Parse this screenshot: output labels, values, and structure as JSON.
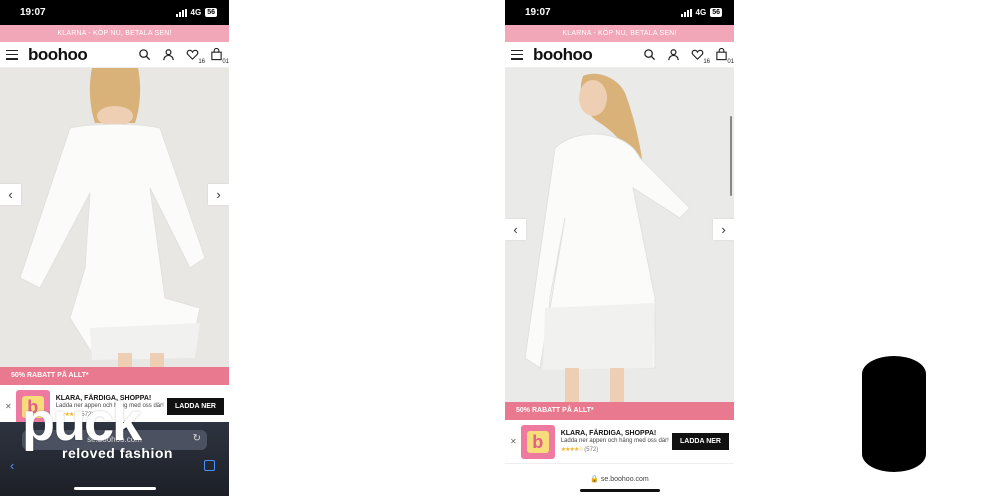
{
  "status": {
    "time": "19:07",
    "network": "4G",
    "battery": "56"
  },
  "promo_bar": "KLARNA - KÖP NU, BETALA SEN!",
  "brand": {
    "logo": "boohoo",
    "wishlist_count": "16",
    "bag_count": "01",
    "pink": "#f2a7b8",
    "sale_pink": "#e9798f"
  },
  "sale_banner": "50% RABATT PÅ ALLT*",
  "app_banner": {
    "title": "KLARA, FÄRDIGA, SHOPPA!",
    "subtitle": "Ladda ner appen och häng med oss där!",
    "stars": "★★★★☆",
    "reviews": "(572)",
    "button": "LADDA NER",
    "icon_letter": "b"
  },
  "browser": {
    "url": "se.boohoo.com"
  },
  "watermark": {
    "main": "puck",
    "sub": "reloved fashion"
  },
  "icons": [
    "menu-icon",
    "search-icon",
    "user-icon",
    "heart-icon",
    "bag-icon",
    "chevron-left-icon",
    "chevron-right-icon",
    "close-icon",
    "reload-icon",
    "tabs-icon",
    "lock-icon"
  ]
}
